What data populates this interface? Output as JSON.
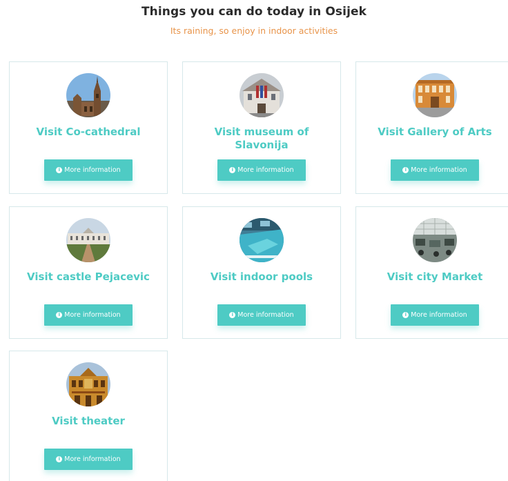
{
  "header": {
    "title": "Things you can do today in Osijek",
    "subtitle": "Its raining, so enjoy in indoor activities"
  },
  "colors": {
    "accent": "#4ecbc4",
    "subtitle": "#e8944a",
    "title": "#2b2b2b",
    "card_border": "#d6e8ea"
  },
  "button_icon": "info-circle-icon",
  "activities": [
    {
      "id": "cocathedral",
      "title": "Visit Co-cathedral",
      "button_label": "More information",
      "image_icon": "cathedral-photo-icon"
    },
    {
      "id": "museum",
      "title": "Visit museum of Slavonija",
      "button_label": "More information",
      "image_icon": "museum-photo-icon"
    },
    {
      "id": "gallery",
      "title": "Visit Gallery of Arts",
      "button_label": "More information",
      "image_icon": "gallery-photo-icon"
    },
    {
      "id": "castle",
      "title": "Visit castle Pejacevic",
      "button_label": "More information",
      "image_icon": "castle-photo-icon"
    },
    {
      "id": "pools",
      "title": "Visit indoor pools",
      "button_label": "More information",
      "image_icon": "pool-photo-icon"
    },
    {
      "id": "market",
      "title": "Visit city Market",
      "button_label": "More information",
      "image_icon": "market-photo-icon"
    },
    {
      "id": "theater",
      "title": "Visit theater",
      "button_label": "More information",
      "image_icon": "theater-photo-icon"
    }
  ]
}
